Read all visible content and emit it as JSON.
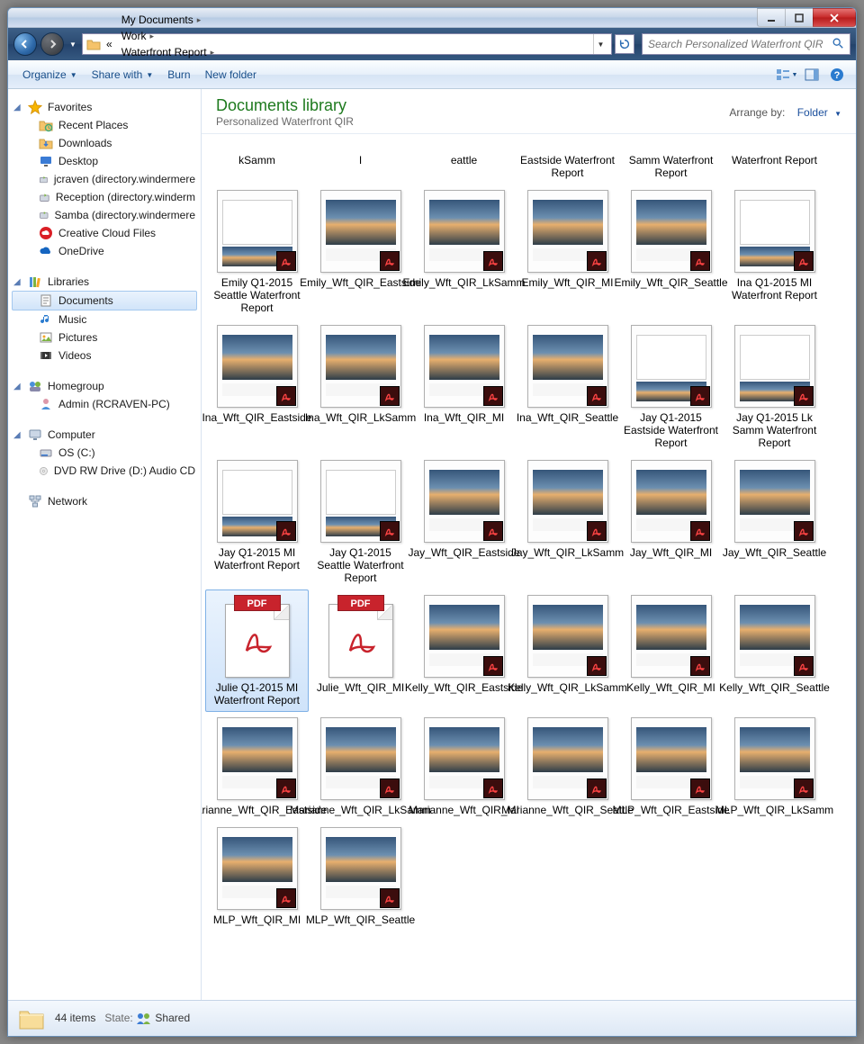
{
  "window_controls": {
    "min": "min",
    "max": "max",
    "close": "close"
  },
  "breadcrumbs": [
    "My Documents",
    "Work",
    "Waterfront Report",
    "Personalized Waterfront QIR"
  ],
  "breadcrumbs_prefix": "«",
  "search": {
    "placeholder": "Search Personalized Waterfront QIR"
  },
  "toolbar": {
    "organize": "Organize",
    "share": "Share with",
    "burn": "Burn",
    "newfolder": "New folder"
  },
  "sidebar": {
    "favorites": {
      "label": "Favorites",
      "items": [
        "Recent Places",
        "Downloads",
        "Desktop",
        "jcraven (directory.windermere",
        "Reception (directory.winderm",
        "Samba (directory.windermere",
        "Creative Cloud Files",
        "OneDrive"
      ]
    },
    "libraries": {
      "label": "Libraries",
      "items": [
        "Documents",
        "Music",
        "Pictures",
        "Videos"
      ],
      "selected": "Documents"
    },
    "homegroup": {
      "label": "Homegroup",
      "items": [
        "Admin (RCRAVEN-PC)"
      ]
    },
    "computer": {
      "label": "Computer",
      "items": [
        "OS (C:)",
        "DVD RW Drive (D:) Audio CD"
      ]
    },
    "network": {
      "label": "Network"
    }
  },
  "library": {
    "title": "Documents library",
    "subtitle": "Personalized Waterfront QIR",
    "arrange_label": "Arrange by:",
    "arrange_value": "Folder"
  },
  "headers": [
    "kSamm",
    "I",
    "eattle",
    "Eastside Waterfront Report",
    "Samm Waterfront Report",
    "Waterfront Report"
  ],
  "files": [
    {
      "name": "Emily Q1-2015 Seattle Waterfront Report",
      "t": "doc"
    },
    {
      "name": "Emily_Wft_QIR_Eastside",
      "t": "photo"
    },
    {
      "name": "Emily_Wft_QIR_LkSamm",
      "t": "photo"
    },
    {
      "name": "Emily_Wft_QIR_MI",
      "t": "photo"
    },
    {
      "name": "Emily_Wft_QIR_Seattle",
      "t": "photo"
    },
    {
      "name": "Ina Q1-2015 MI Waterfront Report",
      "t": "doc"
    },
    {
      "name": "Ina_Wft_QIR_Eastside",
      "t": "photo"
    },
    {
      "name": "Ina_Wft_QIR_LkSamm",
      "t": "photo"
    },
    {
      "name": "Ina_Wft_QIR_MI",
      "t": "photo"
    },
    {
      "name": "Ina_Wft_QIR_Seattle",
      "t": "photo"
    },
    {
      "name": "Jay Q1-2015 Eastside Waterfront Report",
      "t": "doc"
    },
    {
      "name": "Jay Q1-2015 Lk Samm Waterfront Report",
      "t": "doc"
    },
    {
      "name": "Jay Q1-2015 MI Waterfront Report",
      "t": "doc"
    },
    {
      "name": "Jay Q1-2015 Seattle Waterfront Report",
      "t": "doc"
    },
    {
      "name": "Jay_Wft_QIR_Eastside",
      "t": "photo"
    },
    {
      "name": "Jay_Wft_QIR_LkSamm",
      "t": "photo"
    },
    {
      "name": "Jay_Wft_QIR_MI",
      "t": "photo"
    },
    {
      "name": "Jay_Wft_QIR_Seattle",
      "t": "photo"
    },
    {
      "name": "Julie Q1-2015 MI Waterfront Report",
      "t": "pdf",
      "sel": true
    },
    {
      "name": "Julie_Wft_QIR_MI",
      "t": "pdf"
    },
    {
      "name": "Kelly_Wft_QIR_Eastside",
      "t": "photo"
    },
    {
      "name": "Kelly_Wft_QIR_LkSamm",
      "t": "photo"
    },
    {
      "name": "Kelly_Wft_QIR_MI",
      "t": "photo"
    },
    {
      "name": "Kelly_Wft_QIR_Seattle",
      "t": "photo"
    },
    {
      "name": "Marianne_Wft_QIR_Eastside",
      "t": "photo"
    },
    {
      "name": "Marianne_Wft_QIR_LkSamm",
      "t": "photo"
    },
    {
      "name": "Marianne_Wft_QIR_MI",
      "t": "photo"
    },
    {
      "name": "Marianne_Wft_QIR_Seattle",
      "t": "photo"
    },
    {
      "name": "MLP_Wft_QIR_Eastside",
      "t": "photo"
    },
    {
      "name": "MLP_Wft_QIR_LkSamm",
      "t": "photo"
    },
    {
      "name": "MLP_Wft_QIR_MI",
      "t": "photo"
    },
    {
      "name": "MLP_Wft_QIR_Seattle",
      "t": "photo"
    }
  ],
  "status": {
    "count_text": "44 items",
    "state_label": "State:",
    "state_value": "Shared"
  },
  "pdf_label": "PDF"
}
